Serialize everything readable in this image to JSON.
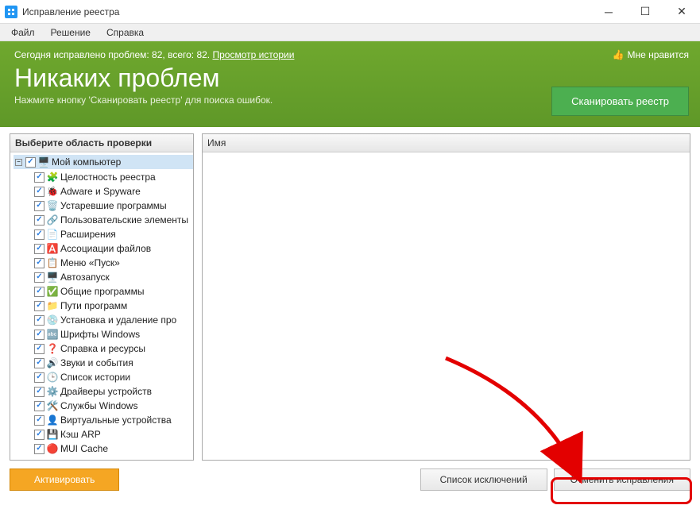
{
  "window": {
    "title": "Исправление реестра"
  },
  "menu": [
    "Файл",
    "Решение",
    "Справка"
  ],
  "banner": {
    "status_prefix": "Сегодня исправлено проблем: 82, всего: 82. ",
    "history_link": "Просмотр истории",
    "heading": "Никаких проблем",
    "subtitle": "Нажмите кнопку 'Сканировать реестр' для поиска ошибок.",
    "like": "Мне нравится",
    "scan": "Сканировать реестр"
  },
  "tree": {
    "header": "Выберите область проверки",
    "root": "Мой компьютер",
    "items": [
      {
        "icon": "🧩",
        "label": "Целостность реестра"
      },
      {
        "icon": "🐞",
        "label": "Adware и Spyware"
      },
      {
        "icon": "🗑️",
        "label": "Устаревшие программы"
      },
      {
        "icon": "🔗",
        "label": "Пользовательские элементы"
      },
      {
        "icon": "📄",
        "label": "Расширения"
      },
      {
        "icon": "🅰️",
        "label": "Ассоциации файлов"
      },
      {
        "icon": "📋",
        "label": "Меню «Пуск»"
      },
      {
        "icon": "🖥️",
        "label": "Автозапуск"
      },
      {
        "icon": "✅",
        "label": "Общие программы"
      },
      {
        "icon": "📁",
        "label": "Пути программ"
      },
      {
        "icon": "💿",
        "label": "Установка и удаление про"
      },
      {
        "icon": "🔤",
        "label": "Шрифты Windows"
      },
      {
        "icon": "❓",
        "label": "Справка и ресурсы"
      },
      {
        "icon": "🔊",
        "label": "Звуки и события"
      },
      {
        "icon": "🕒",
        "label": "Список истории"
      },
      {
        "icon": "⚙️",
        "label": "Драйверы устройств"
      },
      {
        "icon": "🛠️",
        "label": "Службы Windows"
      },
      {
        "icon": "👤",
        "label": "Виртуальные устройства"
      },
      {
        "icon": "💾",
        "label": "Кэш ARP"
      },
      {
        "icon": "🔴",
        "label": "MUI Cache"
      }
    ]
  },
  "list": {
    "header": "Имя"
  },
  "footer": {
    "activate": "Активировать",
    "exclusions": "Список исключений",
    "cancel_fixes": "Отменить исправления"
  }
}
